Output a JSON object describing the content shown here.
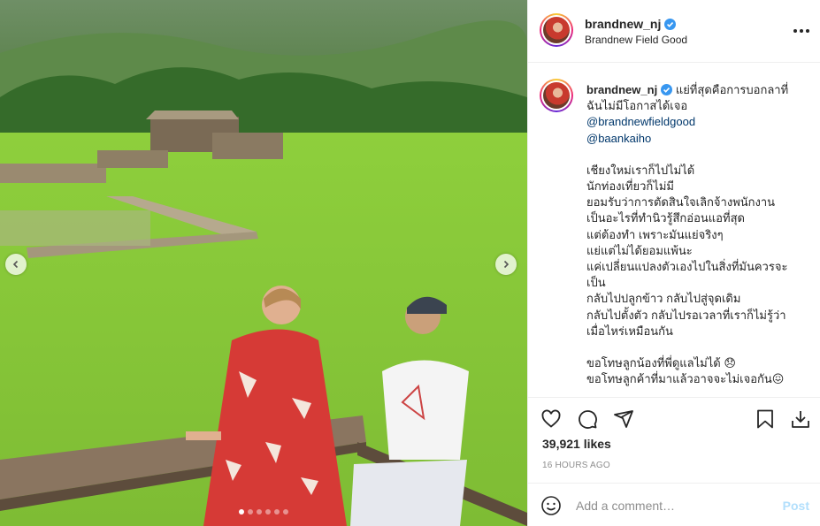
{
  "post": {
    "username": "brandnew_nj",
    "location": "Brandnew Field Good",
    "caption_lines": [
      "แย่ที่สุดคือการบอกลาที่",
      "ฉันไม่มีโอกาสได้เจอ"
    ],
    "mentions": [
      "@brandnewfieldgood",
      "@baankaiho"
    ],
    "body_lines": [
      "เชียงใหม่เราก็ไปไม่ได้",
      "นักท่องเที่ยวก็ไม่มี",
      "ยอมรับว่าการตัดสินใจเลิกจ้างพนักงาน",
      "เป็นอะไรที่ทำนิวรู้สึกอ่อนแอที่สุด",
      "แต่ต้องทำ เพราะมันแย่จริงๆ",
      "แย่แต่ไม่ได้ยอมแพ้นะ",
      "แค่เปลี่ยนแปลงตัวเองไปในสิ่งที่มันควรจะ",
      "เป็น",
      "กลับไปปลูกข้าว กลับไปสู่จุดเดิม",
      "กลับไปตั้งตัว กลับไปรอเวลาที่เราก็ไม่รู้ว่า",
      "เมื่อไหร่เหมือนกัน"
    ],
    "closing_lines": [
      "ขอโทษลูกน้องที่พี่ดูแลไม่ได้ 😞",
      "ขอโทษลูกค้าที่มาแล้วอาจจะไม่เจอกัน😖"
    ],
    "likes": "39,921 likes",
    "timestamp": "16 HOURS AGO"
  },
  "comment": {
    "placeholder": "Add a comment…",
    "post_label": "Post"
  },
  "carousel": {
    "slide_count": 6,
    "active_index": 0
  },
  "colors": {
    "verified": "#3897f0",
    "link": "#00376b",
    "post_disabled": "#b2dffc",
    "muted": "#8e8e8e"
  },
  "icons": [
    "chevron-left-icon",
    "chevron-right-icon",
    "verified-badge-icon",
    "more-icon",
    "heart-icon",
    "comment-icon",
    "share-icon",
    "bookmark-icon",
    "download-icon",
    "emoji-icon"
  ]
}
